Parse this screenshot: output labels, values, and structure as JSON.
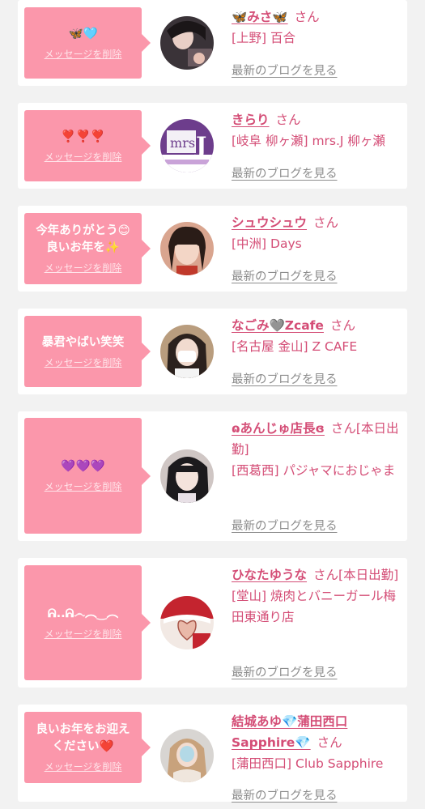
{
  "delete_label": "メッセージを削除",
  "honorific": "さん",
  "blog_label": "最新のブログを見る",
  "accent_color": "#fb97ab",
  "name_color": "#d44d76",
  "link_color": "#8d8d8d",
  "entries": [
    {
      "message": "🦋🩵",
      "name": "🦋みさ🦋",
      "honorific": "さん",
      "shop": "[上野] 百合"
    },
    {
      "message": "❣️❣️❣️",
      "name": "きらり",
      "honorific": "さん",
      "shop": "[岐阜 柳ヶ瀬] mrs.J 柳ヶ瀬"
    },
    {
      "message": "今年ありがとう😊\n良いお年を✨",
      "name": "シュウシュウ",
      "honorific": "さん",
      "shop": "[中洲] Days"
    },
    {
      "message": "暴君やばい笑笑",
      "name": "なごみ🩶Zcafe",
      "honorific": "さん",
      "shop": "[名古屋 金山] Z CAFE"
    },
    {
      "message": "💜💜💜",
      "name": "ɷあんじゅ店長ɞ",
      "honorific": "さん[本日出勤]",
      "shop": "[西葛西] パジャマにおじゃま"
    },
    {
      "message": "ᕱ..ᕱ෴︵‿︵",
      "name": "ひなたゆうな",
      "honorific": "さん[本日出勤]",
      "shop": "[堂山] 焼肉とバニーガール梅田東通り店"
    },
    {
      "message": "良いお年をお迎え\nください❤️",
      "name": "結城あゆ💎蒲田西口Sapphire💎",
      "honorific": "さん",
      "shop": "[蒲田西口] Club Sapphire"
    }
  ]
}
